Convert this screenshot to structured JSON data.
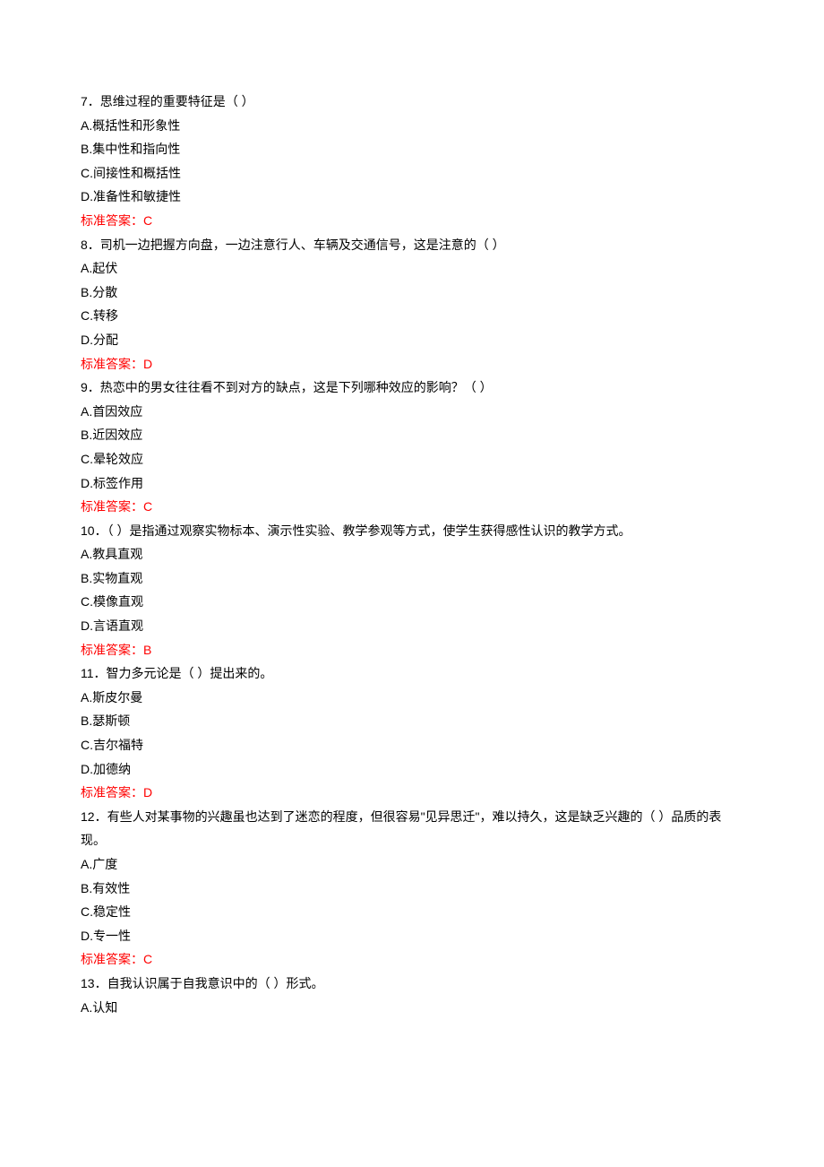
{
  "questions": [
    {
      "stem": "7．思维过程的重要特征是（  ）",
      "options": [
        "A.概括性和形象性",
        "B.集中性和指向性",
        "C.间接性和概括性",
        "D.准备性和敏捷性"
      ],
      "answer": "标准答案：C"
    },
    {
      "stem": "8．司机一边把握方向盘，一边注意行人、车辆及交通信号，这是注意的（    ）",
      "options": [
        "A.起伏",
        "B.分散",
        "C.转移",
        "D.分配"
      ],
      "answer": "标准答案：D"
    },
    {
      "stem": "9．热恋中的男女往往看不到对方的缺点，这是下列哪种效应的影响？（    ）",
      "options": [
        "A.首因效应",
        "B.近因效应",
        "C.晕轮效应",
        "D.标签作用"
      ],
      "answer": "标准答案：C"
    },
    {
      "stem": "10．（     ）是指通过观察实物标本、演示性实验、教学参观等方式，使学生获得感性认识的教学方式。",
      "options": [
        "A.教具直观",
        "B.实物直观",
        "C.模像直观",
        "D.言语直观"
      ],
      "answer": "标准答案：B"
    },
    {
      "stem": "11．智力多元论是（    ）提出来的。",
      "options": [
        "A.斯皮尔曼",
        "B.瑟斯顿",
        "C.吉尔福特",
        "D.加德纳"
      ],
      "answer": "标准答案：D"
    },
    {
      "stem": "12．有些人对某事物的兴趣虽也达到了迷恋的程度，但很容易\"见异思迁\"，难以持久，这是缺乏兴趣的（   ）品质的表现。",
      "options": [
        "A.广度",
        "B.有效性",
        "C.稳定性",
        "D.专一性"
      ],
      "answer": "标准答案：C"
    },
    {
      "stem": "13．自我认识属于自我意识中的（     ）形式。",
      "options": [
        "A.认知"
      ],
      "answer": null
    }
  ]
}
